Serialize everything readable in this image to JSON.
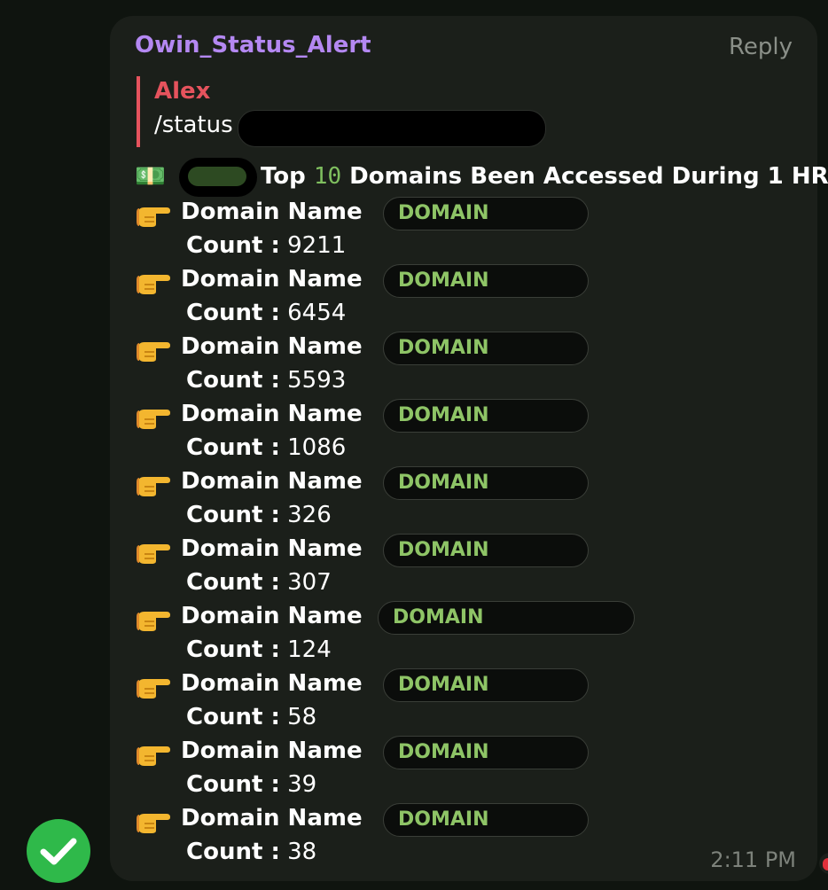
{
  "message": {
    "sender": "Owin_Status_Alert",
    "reply_label": "Reply",
    "quote": {
      "author": "Alex",
      "text": "/status"
    },
    "header": {
      "pre": "Top ",
      "number": "10",
      "post": " Domains Been Accessed During 1  HR"
    },
    "entries": [
      {
        "label": "Domain Name",
        "domain": "DOMAIN",
        "count_label": "Count :",
        "count": "9211"
      },
      {
        "label": "Domain Name",
        "domain": "DOMAIN",
        "count_label": "Count :",
        "count": "6454"
      },
      {
        "label": "Domain Name",
        "domain": "DOMAIN",
        "count_label": "Count :",
        "count": "5593"
      },
      {
        "label": "Domain Name",
        "domain": "DOMAIN",
        "count_label": "Count :",
        "count": "1086"
      },
      {
        "label": "Domain Name",
        "domain": "DOMAIN",
        "count_label": "Count :",
        "count": "326"
      },
      {
        "label": "Domain Name",
        "domain": "DOMAIN",
        "count_label": "Count :",
        "count": "307"
      },
      {
        "label": "Domain Name",
        "domain": "DOMAIN",
        "count_label": "Count :",
        "count": "124"
      },
      {
        "label": "Domain Name",
        "domain": "DOMAIN",
        "count_label": "Count :",
        "count": "58"
      },
      {
        "label": "Domain Name",
        "domain": "DOMAIN",
        "count_label": "Count :",
        "count": "39"
      },
      {
        "label": "Domain Name",
        "domain": "DOMAIN",
        "count_label": "Count :",
        "count": "38"
      }
    ],
    "time": "2:11 PM"
  },
  "icons": {
    "header": "money-icon",
    "entry": "pointing-hand-icon",
    "status": "checkmark-icon",
    "reaction": "heart-icon"
  },
  "colors": {
    "sender": "#b488f2",
    "quote_author": "#e5535d",
    "domain_text": "#8ec466",
    "check": "#2fb94a",
    "bubble": "#1b1f1a"
  }
}
